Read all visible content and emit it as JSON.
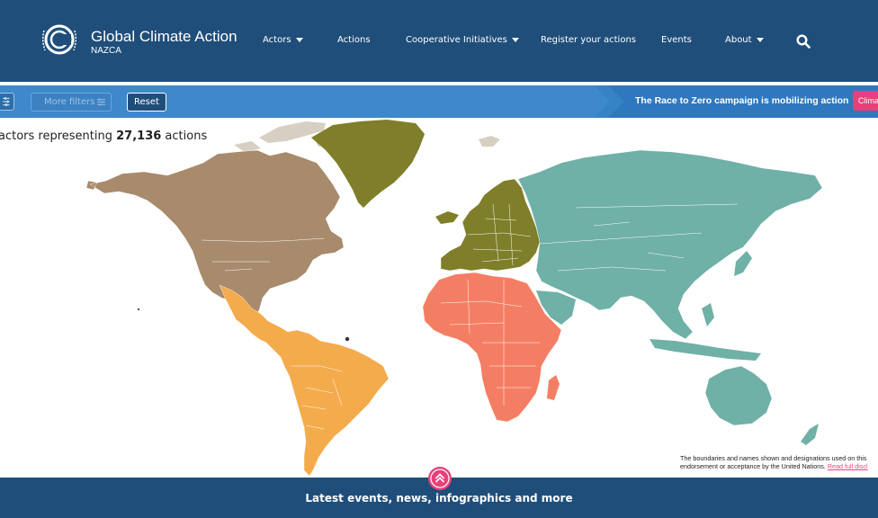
{
  "header": {
    "brand_title": "Global Climate Action",
    "brand_subtitle": "NAZCA",
    "nav": [
      {
        "label": "Actors",
        "dropdown": true
      },
      {
        "label": "Actions",
        "dropdown": false
      },
      {
        "label": "Cooperative Initiatives",
        "dropdown": true
      },
      {
        "label": "Register your actions",
        "dropdown": false
      },
      {
        "label": "Events",
        "dropdown": false
      },
      {
        "label": "About",
        "dropdown": true
      }
    ],
    "search_icon": "search-icon"
  },
  "filters": {
    "more_filters_label": "More filters",
    "reset_label": "Reset"
  },
  "promo": {
    "text": "The Race to Zero campaign is mobilizing action",
    "button_label": "Clima"
  },
  "counter": {
    "prefix": "actors representing ",
    "actions_count": "27,136",
    "suffix": " actions"
  },
  "map": {
    "region_colors": {
      "north_america": "#a88a6c",
      "greenland": "#7f7e2a",
      "europe": "#7f7e2a",
      "latin_america": "#f4ab4c",
      "africa": "#f47e63",
      "asia_pacific": "#6fb0a7",
      "arctic": "#d8cfc3"
    }
  },
  "disclaimer": {
    "line1": "The boundaries and names shown and designations used on this",
    "line2": "endorsement or acceptance by the United Nations. ",
    "link": "Read full discl"
  },
  "footer": {
    "cta": "Latest events, news, infographics and more"
  },
  "colors": {
    "header_bg": "#1f4e7a",
    "filterbar_bg": "#3e88cc",
    "accent": "#e8417a"
  }
}
